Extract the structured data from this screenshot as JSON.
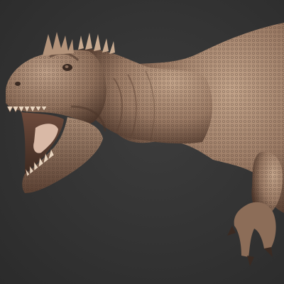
{
  "scene": {
    "subject": "dinosaur-sculpt-render",
    "colors": {
      "background": "#333333",
      "skin_base": "#9a7a64",
      "skin_shadow": "#5a4032",
      "skin_highlight": "#c9aa90",
      "mouth_interior": "#d9b9a6",
      "teeth": "#e8d5c0"
    }
  }
}
